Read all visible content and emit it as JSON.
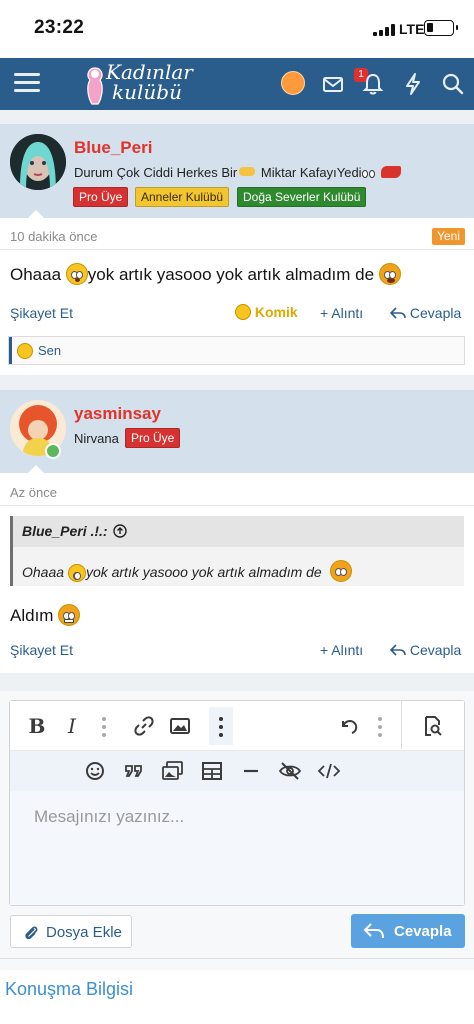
{
  "status_bar": {
    "time": "23:22",
    "network": "LTE"
  },
  "header": {
    "logo_line1": "Kadınlar",
    "logo_line2": "kulübü",
    "notification_count": "1",
    "icons": [
      "menu-icon",
      "avatar",
      "mail-icon",
      "bell-icon",
      "lightning-icon",
      "search-icon"
    ]
  },
  "posts": [
    {
      "username": "Blue_Peri",
      "user_title": "Durum Çok Ciddi Herkes Bir",
      "user_title_2": " Miktar KafayıYedi",
      "badges": [
        "Pro Üye",
        "Anneler Kulübü",
        "Doğa Severler Kulübü"
      ],
      "time": "10 dakika önce",
      "new_label": "Yeni",
      "text_before": "Ohaaa ",
      "text_after": "yok artık yasooo yok artık almadım de ",
      "actions": {
        "report": "Şikayet Et",
        "reaction": "Komik",
        "quote": "+ Alıntı",
        "reply": "Cevapla"
      },
      "reaction_summary": "Sen"
    },
    {
      "username": "yasminsay",
      "user_title": "Nirvana",
      "badges": [
        "Pro Üye"
      ],
      "time": "Az önce",
      "quote_author": "Blue_Peri .!.:",
      "quote_text_before": "Ohaaa ",
      "quote_text_after": "yok artık yasooo yok artık almadım de ",
      "text": "Aldım",
      "actions": {
        "report": "Şikayet Et",
        "quote": "+ Alıntı",
        "reply": "Cevapla"
      }
    }
  ],
  "editor": {
    "placeholder": "Mesajınızı yazınız...",
    "attach_label": "Dosya Ekle",
    "reply_label": "Cevapla"
  },
  "footer": {
    "conversation_info": "Konuşma Bilgisi"
  },
  "colors": {
    "header": "#2b5d8c",
    "post_head": "#d4e0ec",
    "username": "#e1332a",
    "link": "#2b5d8c",
    "reply_button": "#5aa2e0"
  }
}
